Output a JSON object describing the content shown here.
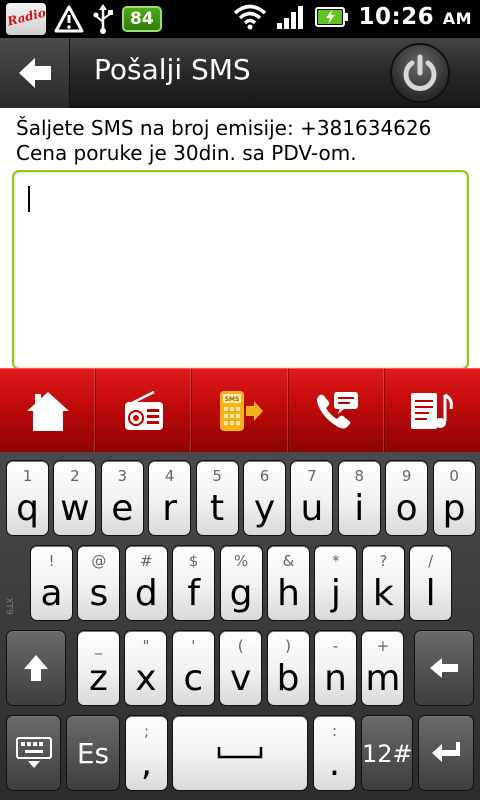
{
  "status_bar": {
    "app_icon_text": "RadioS",
    "battery_level": "84",
    "time": "10:26",
    "ampm": "AM",
    "icons": [
      "warning-icon",
      "usb-icon",
      "battery-badge",
      "wifi-icon",
      "signal-icon",
      "battery-charging-icon"
    ]
  },
  "header": {
    "title": "Pošalji SMS",
    "back_icon": "back-arrow-icon",
    "power_icon": "power-icon"
  },
  "main": {
    "info_text": "Šaljete SMS na broj emisije: +381634626 Cena poruke je 30din. sa PDV-om.",
    "message_value": ""
  },
  "toolbar": {
    "items": [
      {
        "icon": "home-icon"
      },
      {
        "icon": "radio-icon"
      },
      {
        "icon": "sms-icon"
      },
      {
        "icon": "call-message-icon"
      },
      {
        "icon": "notes-music-icon"
      }
    ]
  },
  "keyboard": {
    "row1": [
      {
        "hint": "1",
        "key": "q"
      },
      {
        "hint": "2",
        "key": "w"
      },
      {
        "hint": "3",
        "key": "e"
      },
      {
        "hint": "4",
        "key": "r"
      },
      {
        "hint": "5",
        "key": "t"
      },
      {
        "hint": "6",
        "key": "y"
      },
      {
        "hint": "7",
        "key": "u"
      },
      {
        "hint": "8",
        "key": "i"
      },
      {
        "hint": "9",
        "key": "o"
      },
      {
        "hint": "0",
        "key": "p"
      }
    ],
    "row2": [
      {
        "hint": "!",
        "key": "a"
      },
      {
        "hint": "@",
        "key": "s"
      },
      {
        "hint": "#",
        "key": "d"
      },
      {
        "hint": "$",
        "key": "f"
      },
      {
        "hint": "%",
        "key": "g"
      },
      {
        "hint": "&",
        "key": "h"
      },
      {
        "hint": "*",
        "key": "j"
      },
      {
        "hint": "?",
        "key": "k"
      },
      {
        "hint": "/",
        "key": "l"
      }
    ],
    "row3": [
      {
        "hint": "_",
        "key": "z"
      },
      {
        "hint": "\"",
        "key": "x"
      },
      {
        "hint": "'",
        "key": "c"
      },
      {
        "hint": "(",
        "key": "v"
      },
      {
        "hint": ")",
        "key": "b"
      },
      {
        "hint": "-",
        "key": "n"
      },
      {
        "hint": "+",
        "key": "m"
      }
    ],
    "lang": "Es",
    "punct_hint": ";",
    "punct": ",",
    "dot_hint": ":",
    "dot": ".",
    "symbols": "12#",
    "side_label": "XT9"
  }
}
